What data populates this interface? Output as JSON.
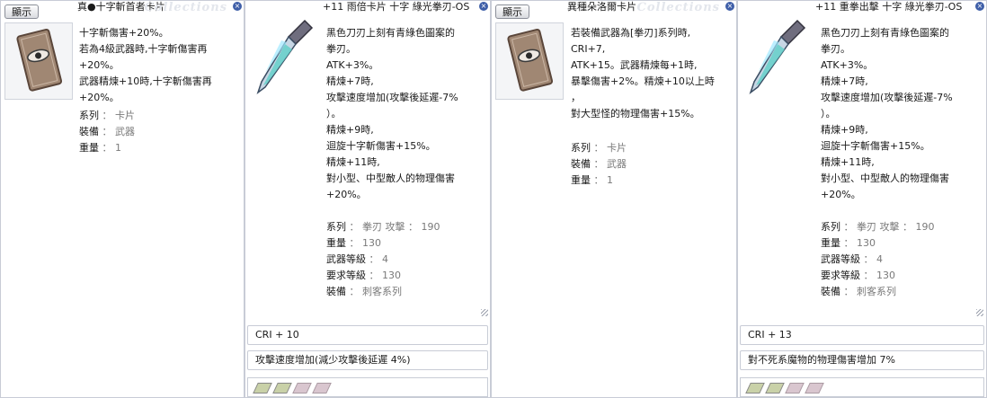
{
  "panels": [
    {
      "show_label": "顯示",
      "title": "真●十字斬首者卡片",
      "watermark": "Collections",
      "lines": [
        "十字斬傷害+20%。",
        "若為4級武器時,十字斬傷害再",
        "+20%。",
        "武器精煉+10時,十字斬傷害再",
        "+20%。"
      ],
      "props": [
        {
          "k": "系列",
          "v": "卡片"
        },
        {
          "k": "裝備",
          "v": "武器"
        },
        {
          "k": "重量",
          "v": "1"
        }
      ]
    },
    {
      "title": "+11 雨倍卡片 十字 綠光拳刃-OS",
      "lines": [
        "黑色刀刃上刻有青綠色圖案的",
        "拳刃。",
        "ATK+3%。",
        "精煉+7時,",
        "攻擊速度增加(攻擊後延遲-7%",
        "）。",
        "精煉+9時,",
        "迴旋十字斬傷害+15%。",
        "精煉+11時,",
        "對小型、中型敵人的物理傷害",
        "+20%。"
      ],
      "props": [
        {
          "k": "系列",
          "v": "拳刃  攻擊 ： 190"
        },
        {
          "k": "重量",
          "v": "130"
        },
        {
          "k": "武器等級",
          "v": "4"
        },
        {
          "k": "要求等級",
          "v": "130"
        },
        {
          "k": "裝備",
          "v": "刺客系列"
        }
      ],
      "sub1": "CRI + 10",
      "sub2": "攻擊速度增加(減少攻擊後延遲 4%)"
    },
    {
      "show_label": "顯示",
      "title": "異種朵洛爾卡片",
      "watermark": "Collections",
      "lines": [
        "若裝備武器為[拳刃]系列時,",
        "CRI+7,",
        "ATK+15。武器精煉每+1時,",
        "暴擊傷害+2%。精煉+10以上時",
        "，",
        "對大型怪的物理傷害+15%。"
      ],
      "props": [
        {
          "k": "系列",
          "v": "卡片"
        },
        {
          "k": "裝備",
          "v": "武器"
        },
        {
          "k": "重量",
          "v": "1"
        }
      ]
    },
    {
      "title": "+11 重拳出擊 十字 綠光拳刃-OS",
      "lines": [
        "黑色刀刃上刻有青綠色圖案的",
        "拳刃。",
        "ATK+3%。",
        "精煉+7時,",
        "攻擊速度增加(攻擊後延遲-7%",
        "）。",
        "精煉+9時,",
        "迴旋十字斬傷害+15%。",
        "精煉+11時,",
        "對小型、中型敵人的物理傷害",
        "+20%。"
      ],
      "props": [
        {
          "k": "系列",
          "v": "拳刃  攻擊 ： 190"
        },
        {
          "k": "重量",
          "v": "130"
        },
        {
          "k": "武器等級",
          "v": "4"
        },
        {
          "k": "要求等級",
          "v": "130"
        },
        {
          "k": "裝備",
          "v": "刺客系列"
        }
      ],
      "sub1": "CRI + 13",
      "sub2": "對不死系魔物的物理傷害增加  7%"
    }
  ],
  "colors": {
    "border": "#c8ccd6",
    "close": "#3f5fa8",
    "prop_value": "#7a7a7a"
  },
  "icons": [
    "card-icon",
    "katar-icon",
    "close-icon",
    "card-slot-icon",
    "resize-grip-icon"
  ]
}
